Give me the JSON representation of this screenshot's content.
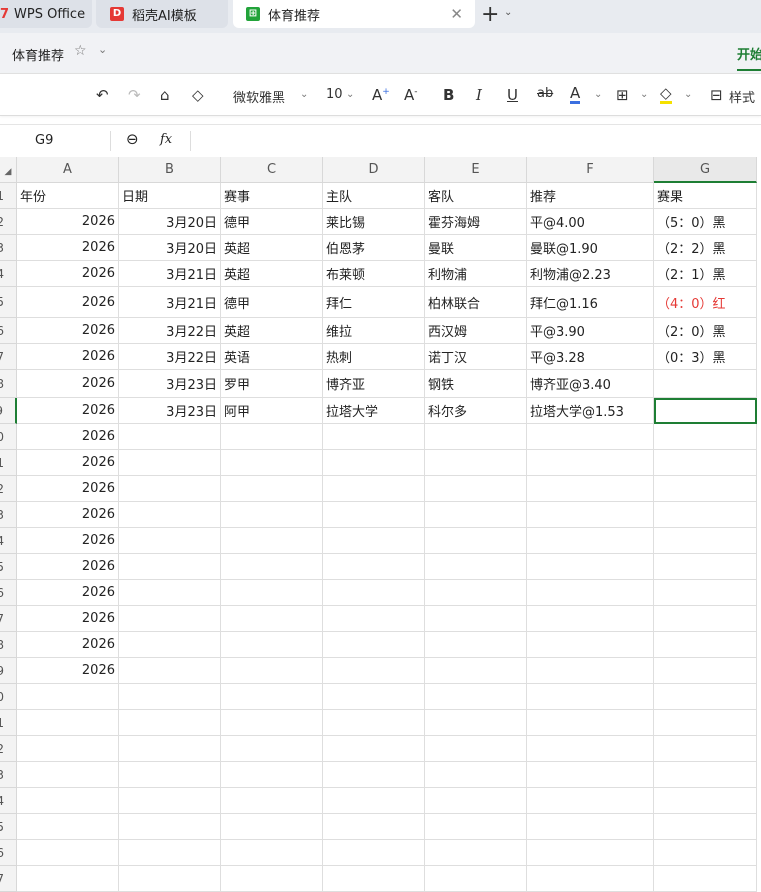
{
  "tabs": [
    {
      "label": "WPS Office"
    },
    {
      "label": "稻壳AI模板"
    },
    {
      "label": "体育推荐"
    }
  ],
  "doc": {
    "title": "体育推荐",
    "ribbon_tab": "开始"
  },
  "toolbar": {
    "font": "微软雅黑",
    "size": "10",
    "style_label": "样式",
    "font_color": "#3b6fe0",
    "highlight_color": "#f5e100"
  },
  "formula_bar": {
    "cell_ref": "G9",
    "fx": "fx",
    "value": ""
  },
  "columns": [
    "A",
    "B",
    "C",
    "D",
    "E",
    "F",
    "G"
  ],
  "header_row": [
    "年份",
    "日期",
    "赛事",
    "主队",
    "客队",
    "推荐",
    "赛果"
  ],
  "rows": [
    [
      "2026",
      "3月20日",
      "德甲",
      "莱比锡",
      "霍芬海姆",
      "平@4.00",
      "（5：0）黑"
    ],
    [
      "2026",
      "3月20日",
      "英超",
      "伯恩茅",
      "曼联",
      "曼联@1.90",
      "（2：2）黑"
    ],
    [
      "2026",
      "3月21日",
      "英超",
      "布莱顿",
      "利物浦",
      "利物浦@2.23",
      "（2：1）黑"
    ],
    [
      "2026",
      "3月21日",
      "德甲",
      "拜仁",
      "柏林联合",
      "拜仁@1.16",
      "（4：0）红"
    ],
    [
      "2026",
      "3月22日",
      "英超",
      "维拉",
      "西汉姆",
      "平@3.90",
      "（2：0）黑"
    ],
    [
      "2026",
      "3月22日",
      "英语",
      "热刺",
      "诺丁汉",
      "平@3.28",
      "（0：3）黑"
    ],
    [
      "2026",
      "3月23日",
      "罗甲",
      "博齐亚",
      "钢铁",
      "博齐亚@3.40",
      ""
    ],
    [
      "2026",
      "3月23日",
      "阿甲",
      "拉塔大学",
      "科尔多",
      "拉塔大学@1.53",
      ""
    ],
    [
      "2026"
    ],
    [
      "2026"
    ],
    [
      "2026"
    ],
    [
      "2026"
    ],
    [
      "2026"
    ],
    [
      "2026"
    ],
    [
      "2026"
    ],
    [
      "2026"
    ],
    [
      "2026"
    ],
    [
      "2026"
    ]
  ],
  "red_color": "#e53935",
  "accent": "#1e7e34"
}
